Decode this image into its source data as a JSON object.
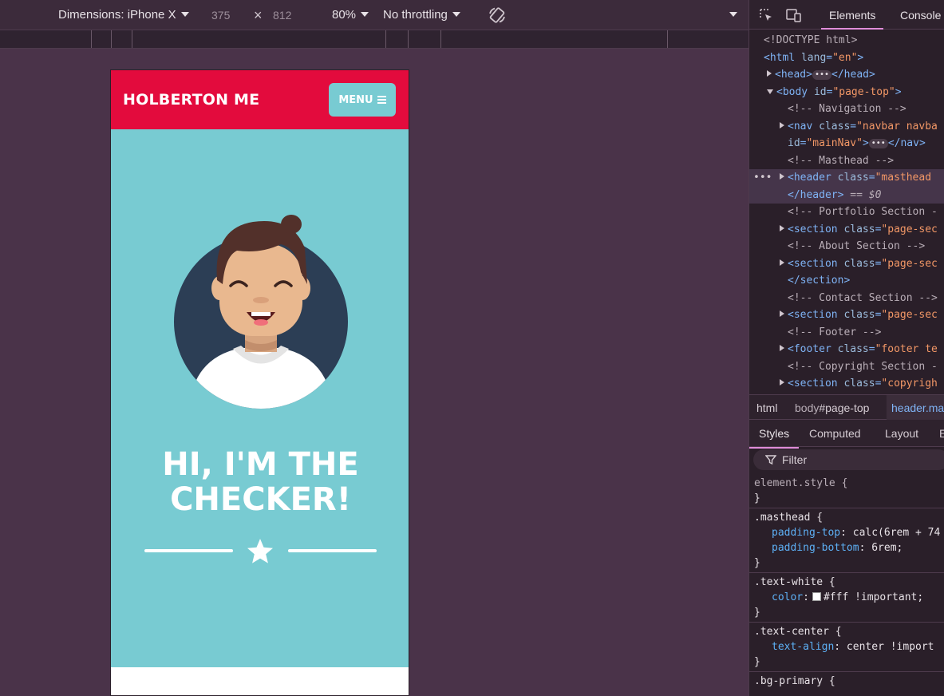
{
  "device_toolbar": {
    "dimensions_label": "Dimensions: iPhone X",
    "width": "375",
    "height": "812",
    "zoom": "80%",
    "throttling": "No throttling"
  },
  "page": {
    "brand": "HOLBERTON ME",
    "menu_label": "MENU",
    "heading_line1": "HI, I'M THE",
    "heading_line2": "CHECKER!",
    "colors": {
      "primary": "#e30b3d",
      "secondary": "#78cbd2"
    }
  },
  "devtools": {
    "tabs": [
      "Elements",
      "Console"
    ],
    "dom": {
      "doctype": "<!DOCTYPE html>",
      "html_open": "<html",
      "html_attr": "lang",
      "html_val": "\"en\"",
      "head": "<head>",
      "head_close": "</head>",
      "body_open": "<body",
      "body_attr": "id",
      "body_val": "\"page-top\"",
      "cmt_nav": "<!-- Navigation -->",
      "nav_open": "<nav",
      "nav_attr": "class",
      "nav_val": "\"navbar navba",
      "nav_id_attr": "id",
      "nav_id_val": "\"mainNav\"",
      "nav_close": "</nav>",
      "cmt_masthead": "<!-- Masthead -->",
      "header_open": "<header",
      "header_attr": "class",
      "header_val": "\"masthead",
      "header_close": "</header>",
      "header_eq": "== $0",
      "cmt_portfolio": "<!-- Portfolio Section -",
      "section_open": "<section",
      "section_attr": "class",
      "section_val": "\"page-sec",
      "cmt_about": "<!-- About Section -->",
      "section_close": "</section>",
      "cmt_contact": "<!-- Contact Section -->",
      "cmt_footer": "<!-- Footer -->",
      "footer_open": "<footer",
      "footer_attr": "class",
      "footer_val": "\"footer te",
      "cmt_copyright": "<!-- Copyright Section -",
      "copyright_val": "\"copyrigh"
    },
    "breadcrumbs": {
      "html": "html",
      "body_tag": "body",
      "body_id": "#page-top",
      "header_tag": "header",
      "header_class": ".ma"
    },
    "style_tabs": [
      "Styles",
      "Computed",
      "Layout",
      "E"
    ],
    "filter_placeholder": "Filter",
    "rules": {
      "element_style": "element.style {",
      "masthead_sel": ".masthead {",
      "masthead_p1_name": "padding-top",
      "masthead_p1_val": ": calc(6rem + 74",
      "masthead_p2_name": "padding-bottom",
      "masthead_p2_val": ": 6rem;",
      "textwhite_sel": ".text-white {",
      "textwhite_p_name": "color",
      "textwhite_p_val": "#fff !important;",
      "textcenter_sel": ".text-center {",
      "textcenter_p_name": "text-align",
      "textcenter_p_val": ": center !import",
      "bgprimary_sel": ".bg-primary {",
      "close": "}"
    }
  }
}
